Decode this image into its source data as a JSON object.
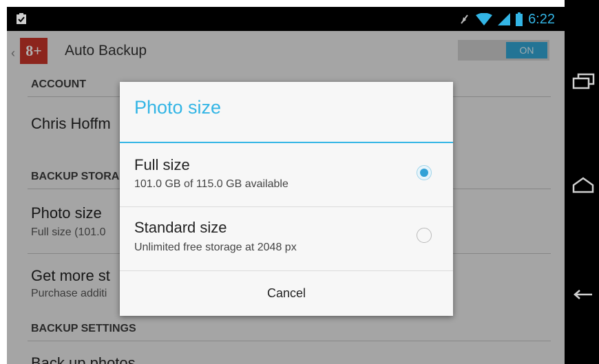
{
  "status_bar": {
    "time": "6:22",
    "left_icon": "clipboard-check-icon",
    "right_icons": [
      "vibrate-icon",
      "wifi-icon",
      "signal-icon",
      "battery-icon"
    ],
    "accent": "#33b5e5"
  },
  "action_bar": {
    "title": "Auto Backup",
    "app_icon_text": "8+",
    "toggle_label": "ON"
  },
  "settings": {
    "account_header": "ACCOUNT",
    "account_name": "Chris Hoffm",
    "backup_storage_header": "BACKUP STORA",
    "photo_size_title": "Photo size",
    "photo_size_sub": "Full size (101.0",
    "get_more_title": "Get more st",
    "get_more_sub": "Purchase additi",
    "backup_settings_header": "BACKUP SETTINGS",
    "backup_photos_title": "Back up photos"
  },
  "dialog": {
    "title": "Photo size",
    "options": [
      {
        "label": "Full size",
        "sub": "101.0 GB of 115.0 GB available",
        "selected": true
      },
      {
        "label": "Standard size",
        "sub": "Unlimited free storage at 2048 px",
        "selected": false
      }
    ],
    "cancel_label": "Cancel"
  },
  "nav_bar": {
    "icons": [
      "recent-apps-icon",
      "home-icon",
      "back-icon"
    ]
  }
}
